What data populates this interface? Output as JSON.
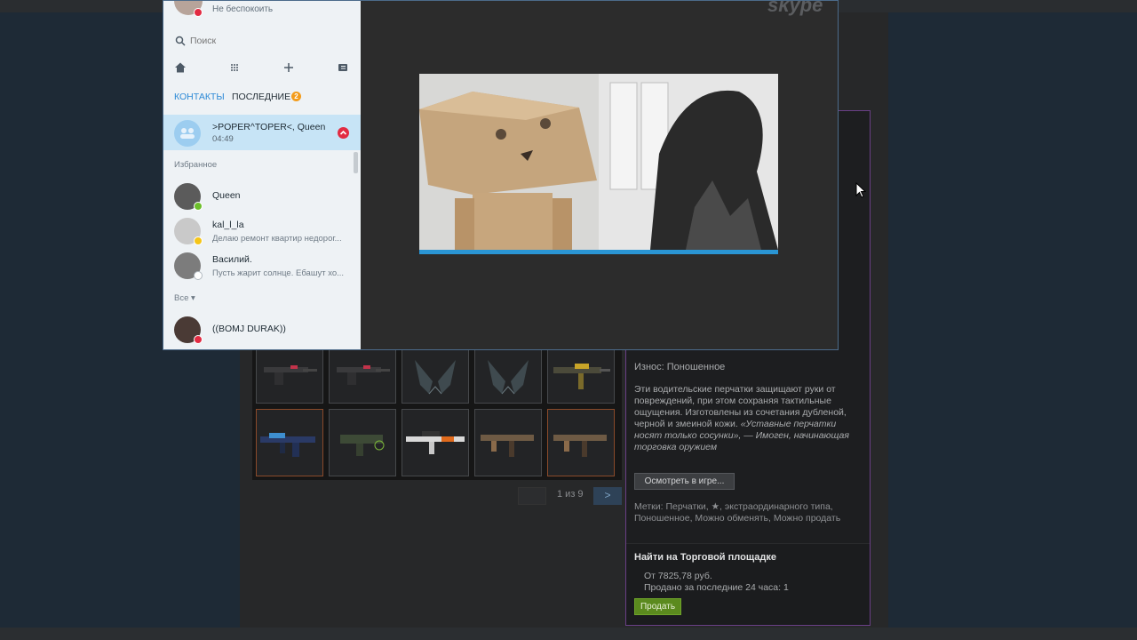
{
  "skype": {
    "status": "Не беспокоить",
    "search_placeholder": "Поиск",
    "tabs": {
      "contacts": "КОНТАКТЫ",
      "recent": "ПОСЛЕДНИЕ",
      "recent_badge": "2"
    },
    "active_conversation": {
      "name": ">POPER^TOPER<, Queen",
      "time": "04:49"
    },
    "favorites_label": "Избранное",
    "favorites": [
      {
        "name": "Queen",
        "message": "",
        "presence": "online"
      },
      {
        "name": "kal_l_la",
        "message": "Делаю ремонт квартир недорог...",
        "presence": "away"
      },
      {
        "name": "Василий.",
        "message": "Пусть жарит солнце. Ебашут хо...",
        "presence": "offline"
      }
    ],
    "all_label": "Все",
    "all": [
      {
        "name": "((BOMJ DURAK))",
        "presence": "busy"
      }
    ],
    "logo": "skype"
  },
  "inventory": {
    "pager": {
      "info": "1 из 9",
      "next": ">"
    }
  },
  "item": {
    "wear": "Износ: Поношенное",
    "description": "Эти водительские перчатки защищают руки от повреждений, при этом сохраняя тактильные ощущения. Изготовлены из сочетания дубленой, черной и змеиной кожи.",
    "quote": "«Уставные перчатки носят только сосунки», — Имоген, начинающая торговка оружием",
    "inspect_button": "Осмотреть в игре...",
    "tags": "Метки: Перчатки, ★, экстраординарного типа, Поношенное, Можно обменять, Можно продать",
    "market": {
      "title": "Найти на Торговой площадке",
      "from": "От 7825,78 руб.",
      "sold": "Продано за последние 24 часа: 1",
      "sell_button": "Продать"
    }
  },
  "colors": {
    "accent_blue": "#2d8ad6",
    "rarity_border": "#6a3f86",
    "sell_green": "#5b8a1e",
    "busy_red": "#e22b42"
  }
}
